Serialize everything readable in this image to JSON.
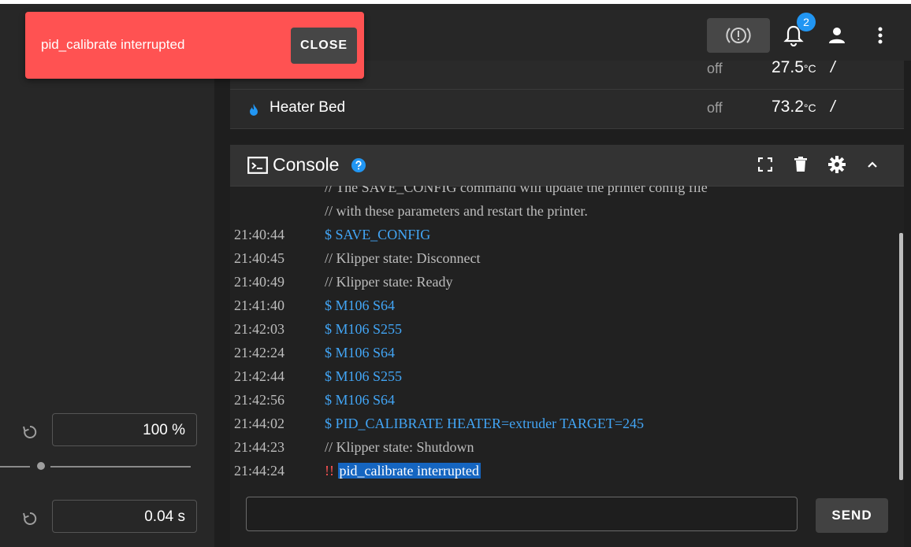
{
  "toast": {
    "message": "pid_calibrate interrupted",
    "close_label": "CLOSE"
  },
  "appbar": {
    "notification_count": "2",
    "icons": [
      "emergency-stop-icon",
      "bell-icon",
      "account-icon",
      "more-vert-icon"
    ]
  },
  "heaters": [
    {
      "name": "",
      "state": "off",
      "temp": "27.5",
      "unit": "°C",
      "slash": "/"
    },
    {
      "name": "Heater Bed",
      "state": "off",
      "temp": "73.2",
      "unit": "°C",
      "slash": "/"
    }
  ],
  "console": {
    "title": "Console",
    "lines": [
      {
        "time": "",
        "msg": "// The SAVE_CONFIG command will update the printer config file",
        "kind": "comment"
      },
      {
        "time": "",
        "msg": "// with these parameters and restart the printer.",
        "kind": "comment"
      },
      {
        "time": "21:40:44",
        "msg": "$ SAVE_CONFIG",
        "kind": "cmd"
      },
      {
        "time": "21:40:45",
        "msg": "// Klipper state: Disconnect",
        "kind": "comment"
      },
      {
        "time": "21:40:49",
        "msg": "// Klipper state: Ready",
        "kind": "comment"
      },
      {
        "time": "21:41:40",
        "msg": "$ M106 S64",
        "kind": "cmd"
      },
      {
        "time": "21:42:03",
        "msg": "$ M106 S255",
        "kind": "cmd"
      },
      {
        "time": "21:42:24",
        "msg": "$ M106 S64",
        "kind": "cmd"
      },
      {
        "time": "21:42:44",
        "msg": "$ M106 S255",
        "kind": "cmd"
      },
      {
        "time": "21:42:56",
        "msg": "$ M106 S64",
        "kind": "cmd"
      },
      {
        "time": "21:44:02",
        "msg": "$ PID_CALIBRATE HEATER=extruder TARGET=245",
        "kind": "cmd"
      },
      {
        "time": "21:44:23",
        "msg": "// Klipper state: Shutdown",
        "kind": "comment"
      },
      {
        "time": "21:44:24",
        "prefix": "!!",
        "msg": "pid_calibrate interrupted",
        "kind": "error"
      }
    ],
    "input_value": "",
    "send_label": "SEND"
  },
  "left_panel": {
    "speed_factor": "100 %",
    "pressure_advance": "0.04 s"
  },
  "colors": {
    "toast": "#ff5252",
    "accent": "#2196f3",
    "command": "#42a5f5",
    "error": "#ff5252"
  }
}
